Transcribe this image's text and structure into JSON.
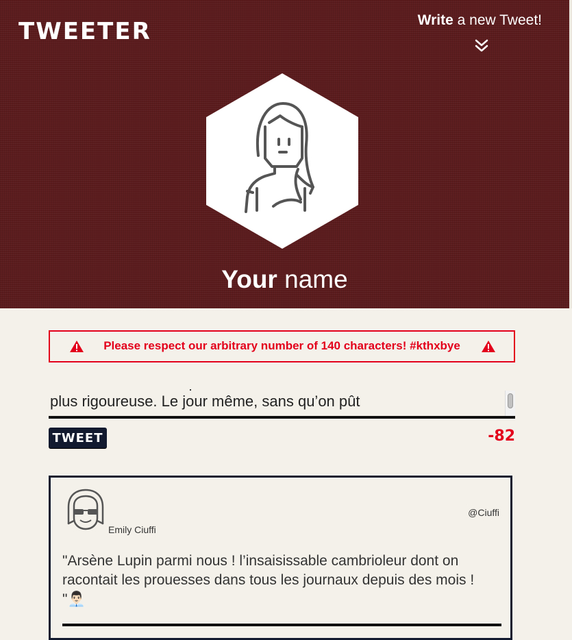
{
  "header": {
    "logo": "TWEETER",
    "compose_bold": "Write",
    "compose_rest": " a new Tweet!",
    "profile_name_bold": "Your",
    "profile_name_rest": " name",
    "background_color": "#5b1b1d"
  },
  "error": {
    "message": "Please respect our arbitrary number of 140 characters! #kthxbye",
    "color": "#e3001b"
  },
  "composer": {
    "text": "plus rigoureuse. Le jour même, sans qu’on pût",
    "tweet_button_label": "TWEET",
    "char_counter": "-82"
  },
  "tweets": [
    {
      "author_name": "Emily Ciuffi",
      "handle": "@Ciuffi",
      "content": "\"Arsène Lupin parmi nous ! l’insaisissable cambrioleur dont on racontait les prouesses dans tous les journaux depuis des mois ! \"👨🏻‍💼"
    }
  ]
}
